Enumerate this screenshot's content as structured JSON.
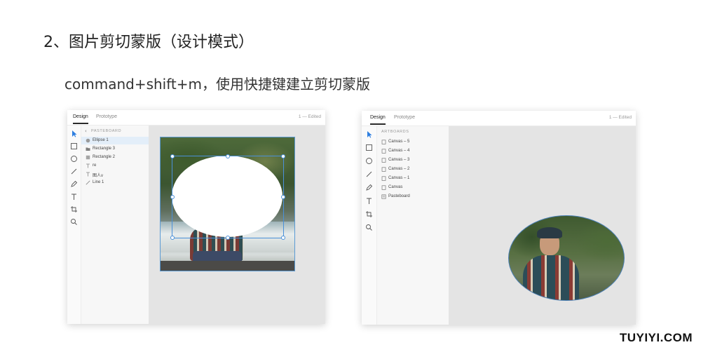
{
  "heading": "2、图片剪切蒙版（设计模式）",
  "subheading": "command+shift+m，使用快捷键建立剪切蒙版",
  "watermark": "TUYIYI.COM",
  "window_left": {
    "tabs": {
      "design": "Design",
      "prototype": "Prototype"
    },
    "doc_status": "1 — Edited",
    "layers_header": "PASTEBOARD",
    "layers": [
      {
        "label": "Ellipse 1",
        "icon": "ellipse-layer-icon",
        "selected": true
      },
      {
        "label": "Rectangle 3",
        "icon": "folder-icon",
        "selected": false
      },
      {
        "label": "Rectangle 2",
        "icon": "rectangle-layer-icon",
        "selected": false
      },
      {
        "label": "re",
        "icon": "text-layer-icon",
        "selected": false
      },
      {
        "label": "图人v",
        "icon": "text-layer-icon",
        "selected": false
      },
      {
        "label": "Line 1",
        "icon": "line-layer-icon",
        "selected": false
      }
    ]
  },
  "window_right": {
    "tabs": {
      "design": "Design",
      "prototype": "Prototype"
    },
    "doc_status": "1 — Edited",
    "layers_header": "ARTBOARDS",
    "layers": [
      {
        "label": "Canvas – 5",
        "icon": "artboard-icon"
      },
      {
        "label": "Canvas – 4",
        "icon": "artboard-icon"
      },
      {
        "label": "Canvas – 3",
        "icon": "artboard-icon"
      },
      {
        "label": "Canvas – 2",
        "icon": "artboard-icon"
      },
      {
        "label": "Canvas – 1",
        "icon": "artboard-icon"
      },
      {
        "label": "Canvas",
        "icon": "artboard-icon"
      },
      {
        "label": "Pasteboard",
        "icon": "pasteboard-icon"
      }
    ]
  },
  "tools": [
    "select-tool-icon",
    "rectangle-tool-icon",
    "ellipse-tool-icon",
    "line-tool-icon",
    "pen-tool-icon",
    "text-tool-icon",
    "artboard-tool-icon",
    "zoom-tool-icon"
  ],
  "colors": {
    "accent": "#4a90d9",
    "canvas": "#e4e4e4",
    "selection": "#e3eef9"
  }
}
